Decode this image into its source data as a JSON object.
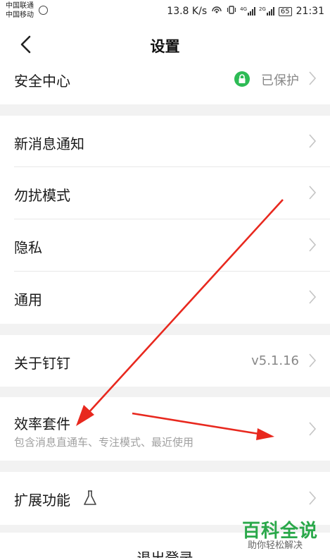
{
  "status_bar": {
    "carrier_1": "中国联通",
    "carrier_2": "中国移动",
    "network_speed": "13.8 K/s",
    "net_1": "4G",
    "net_2": "2G",
    "battery": "65",
    "time": "21:31"
  },
  "header": {
    "title": "设置",
    "back_icon": "chevron-left-icon"
  },
  "rows": {
    "security": {
      "label": "安全中心",
      "value": "已保护",
      "icon": "lock-icon"
    },
    "notifications": {
      "label": "新消息通知"
    },
    "dnd": {
      "label": "勿扰模式"
    },
    "privacy": {
      "label": "隐私"
    },
    "general": {
      "label": "通用"
    },
    "about": {
      "label": "关于钉钉",
      "value": "v5.1.16"
    },
    "efficiency": {
      "label": "效率套件",
      "subtitle": "包含消息直通车、专注模式、最近使用"
    },
    "extensions": {
      "label": "扩展功能",
      "icon": "flask-icon"
    }
  },
  "logout": {
    "label": "退出登录"
  },
  "watermark": {
    "title": "百科全说",
    "subtitle": "助你轻松解决"
  },
  "annotations": {
    "arrow_color": "#e8281e"
  },
  "colors": {
    "accent_green": "#2dbb55",
    "background": "#f2f2f2"
  }
}
